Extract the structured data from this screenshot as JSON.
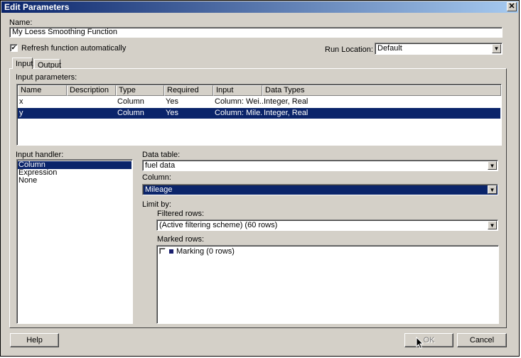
{
  "window": {
    "title": "Edit Parameters"
  },
  "name_label": "Name:",
  "name_value": "My Loess Smoothing Function",
  "refresh_label": "Refresh function automatically",
  "refresh_checked": "✔",
  "run_location_label": "Run Location:",
  "run_location_value": "Default",
  "tabs": [
    {
      "label": "Input"
    },
    {
      "label": "Output"
    }
  ],
  "input_params_label": "Input parameters:",
  "table": {
    "columns": [
      "Name",
      "Description",
      "Type",
      "Required",
      "Input",
      "Data Types"
    ],
    "rows": [
      [
        "x",
        "",
        "Column",
        "Yes",
        "Column: Wei...",
        "Integer, Real"
      ],
      [
        "y",
        "",
        "Column",
        "Yes",
        "Column: Mile...",
        "Integer, Real"
      ]
    ]
  },
  "input_handler_label": "Input handler:",
  "input_handlers": [
    "Column",
    "Expression",
    "None"
  ],
  "data_table_label": "Data table:",
  "data_table_value": "fuel data",
  "column_label": "Column:",
  "column_value": "Mileage",
  "limit_by_label": "Limit by:",
  "filtered_rows_label": "Filtered rows:",
  "filtered_rows_value": "(Active filtering scheme) (60 rows)",
  "marked_rows_label": "Marked rows:",
  "marking_label": "Marking (0 rows)",
  "marking_color": "#1a1f6e",
  "buttons": {
    "help": "Help",
    "ok": "OK",
    "cancel": "Cancel"
  },
  "arrow_glyph": "▼",
  "close_glyph": "✕"
}
